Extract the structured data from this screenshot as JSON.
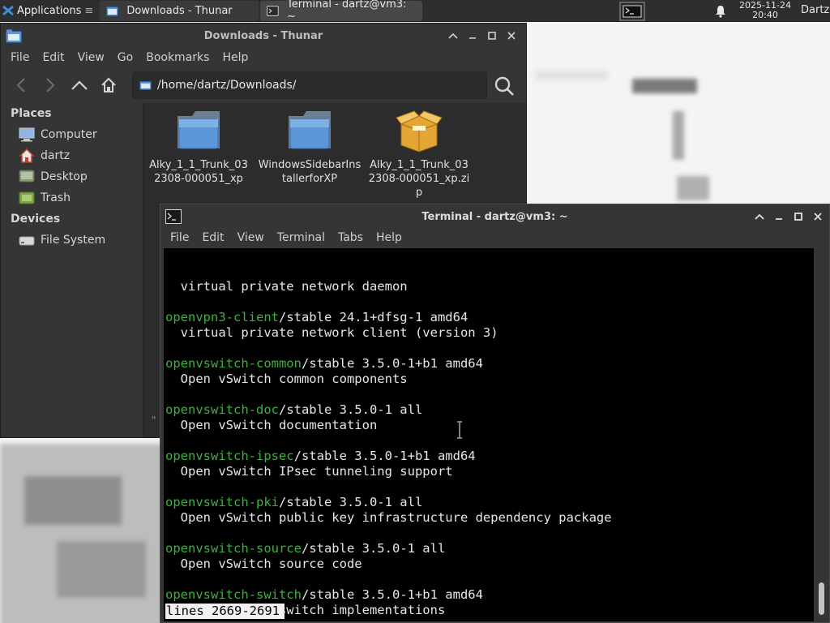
{
  "panel": {
    "applications_label": "Applications",
    "applications_suffix": "≡",
    "tasks": [
      {
        "label": "Downloads - Thunar",
        "icon": "folder-icon"
      },
      {
        "label": "Terminal - dartz@vm3: ~",
        "icon": "terminal-icon"
      }
    ],
    "clock_date": "2025-11-24",
    "clock_time": "20:40",
    "user": "Dartz"
  },
  "thunar": {
    "title": "Downloads - Thunar",
    "menu": [
      "File",
      "Edit",
      "View",
      "Go",
      "Bookmarks",
      "Help"
    ],
    "location": "/home/dartz/Downloads/",
    "sidebar": {
      "places_heading": "Places",
      "places": [
        {
          "label": "Computer",
          "icon": "computer-icon"
        },
        {
          "label": "dartz",
          "icon": "home-icon"
        },
        {
          "label": "Desktop",
          "icon": "desktop-icon"
        },
        {
          "label": "Trash",
          "icon": "trash-icon"
        }
      ],
      "devices_heading": "Devices",
      "devices": [
        {
          "label": "File System",
          "icon": "drive-icon"
        }
      ]
    },
    "files": [
      {
        "name_line1": "Alky_1_1_Trunk_03",
        "name_line2": "2308-000051_xp",
        "name_line3": "",
        "icon": "folder-icon"
      },
      {
        "name_line1": "WindowsSidebarIns",
        "name_line2": "tallerforXP",
        "name_line3": "",
        "icon": "folder-icon"
      },
      {
        "name_line1": "Alky_1_1_Trunk_03",
        "name_line2": "2308-000051_xp.zi",
        "name_line3": "p",
        "icon": "package-icon"
      }
    ],
    "statusbar_fragment": "\""
  },
  "terminal": {
    "title": "Terminal - dartz@vm3: ~",
    "menu": [
      "File",
      "Edit",
      "View",
      "Terminal",
      "Tabs",
      "Help"
    ],
    "lines": [
      {
        "pkg": "",
        "rest": "  virtual private network daemon"
      },
      {
        "pkg": "",
        "rest": ""
      },
      {
        "pkg": "openvpn3-client",
        "rest": "/stable 24.1+dfsg-1 amd64"
      },
      {
        "pkg": "",
        "rest": "  virtual private network client (version 3)"
      },
      {
        "pkg": "",
        "rest": ""
      },
      {
        "pkg": "openvswitch-common",
        "rest": "/stable 3.5.0-1+b1 amd64"
      },
      {
        "pkg": "",
        "rest": "  Open vSwitch common components"
      },
      {
        "pkg": "",
        "rest": ""
      },
      {
        "pkg": "openvswitch-doc",
        "rest": "/stable 3.5.0-1 all"
      },
      {
        "pkg": "",
        "rest": "  Open vSwitch documentation"
      },
      {
        "pkg": "",
        "rest": ""
      },
      {
        "pkg": "openvswitch-ipsec",
        "rest": "/stable 3.5.0-1+b1 amd64"
      },
      {
        "pkg": "",
        "rest": "  Open vSwitch IPsec tunneling support"
      },
      {
        "pkg": "",
        "rest": ""
      },
      {
        "pkg": "openvswitch-pki",
        "rest": "/stable 3.5.0-1 all"
      },
      {
        "pkg": "",
        "rest": "  Open vSwitch public key infrastructure dependency package"
      },
      {
        "pkg": "",
        "rest": ""
      },
      {
        "pkg": "openvswitch-source",
        "rest": "/stable 3.5.0-1 all"
      },
      {
        "pkg": "",
        "rest": "  Open vSwitch source code"
      },
      {
        "pkg": "",
        "rest": ""
      },
      {
        "pkg": "openvswitch-switch",
        "rest": "/stable 3.5.0-1+b1 amd64"
      },
      {
        "pkg": "",
        "rest": "  Open vSwitch switch implementations"
      },
      {
        "pkg": "",
        "rest": ""
      }
    ],
    "pager_status": "lines 2669-2691"
  },
  "colors": {
    "package_name": "#3bb33b",
    "terminal_bg": "#000000",
    "window_bg": "#353535",
    "panel_bg": "#2e2e2e"
  }
}
